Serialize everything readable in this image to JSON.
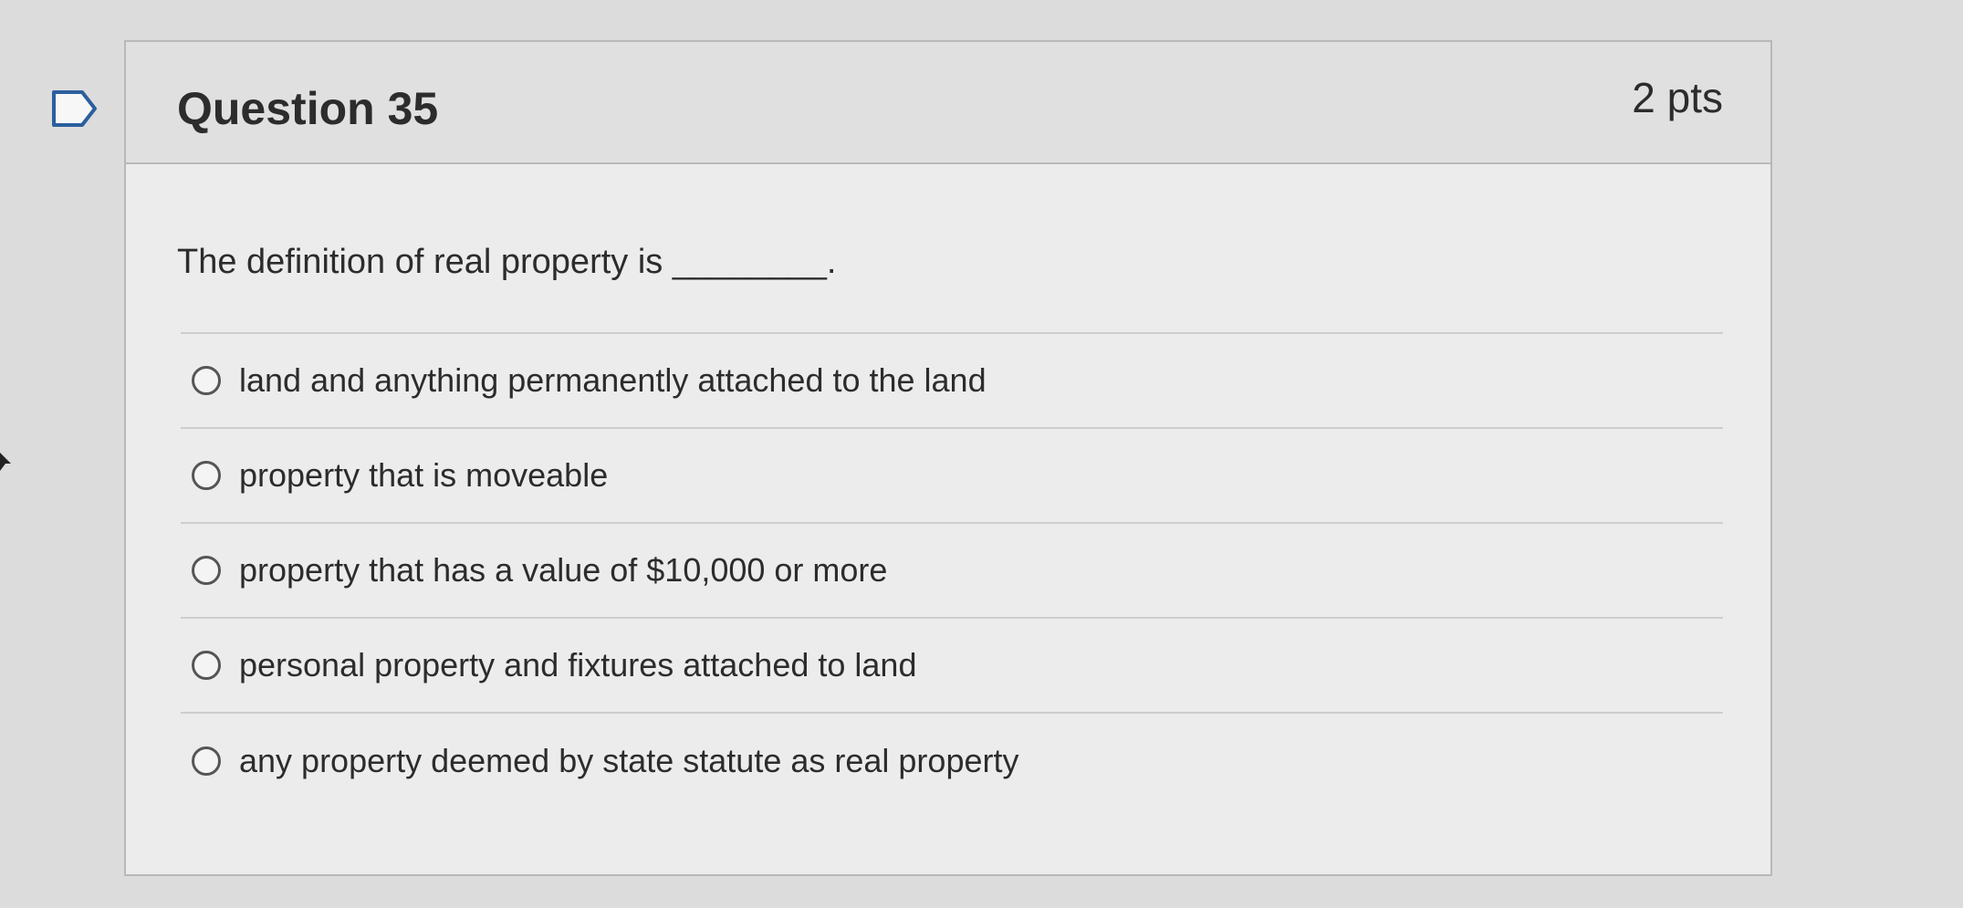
{
  "question": {
    "title": "Question 35",
    "points": "2 pts",
    "text": "The definition of real property is ________.",
    "flag_icon": "flag-icon"
  },
  "answers": [
    {
      "label": "land and anything permanently attached to the land",
      "selected": false
    },
    {
      "label": "property that is moveable",
      "selected": false
    },
    {
      "label": "property that has a value of $10,000 or more",
      "selected": false
    },
    {
      "label": "personal property and fixtures attached to land",
      "selected": false
    },
    {
      "label": "any property deemed by state statute as real property",
      "selected": false
    }
  ]
}
